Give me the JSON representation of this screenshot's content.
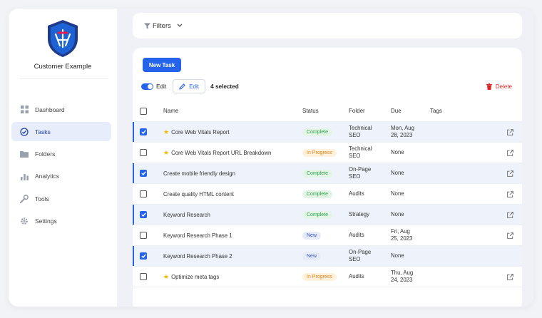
{
  "app": {
    "brand": "Customer Example"
  },
  "sidebar": {
    "items": [
      {
        "label": "Dashboard",
        "icon": "dashboard-icon",
        "active": false
      },
      {
        "label": "Tasks",
        "icon": "tasks-icon",
        "active": true
      },
      {
        "label": "Folders",
        "icon": "folder-icon",
        "active": false
      },
      {
        "label": "Analytics",
        "icon": "analytics-icon",
        "active": false
      },
      {
        "label": "Tools",
        "icon": "tools-icon",
        "active": false
      },
      {
        "label": "Settings",
        "icon": "gear-icon",
        "active": false
      }
    ]
  },
  "filters": {
    "label": "Filters"
  },
  "toolbar": {
    "new_task_label": "New Task",
    "toggle_label": "Edit",
    "edit_label": "Edit",
    "selected_text": "4 selected",
    "delete_label": "Delete"
  },
  "table": {
    "headers": {
      "name": "Name",
      "status": "Status",
      "folder": "Folder",
      "due": "Due",
      "tags": "Tags"
    },
    "rows": [
      {
        "checked": true,
        "starred": true,
        "name": "Core Web Vitals Report",
        "status": "Complete",
        "folder_line1": "Technical",
        "folder_line2": "SEO",
        "due_line1": "Mon, Aug",
        "due_line2": "28, 2023",
        "open_icon": true
      },
      {
        "checked": false,
        "starred": true,
        "name": "Core Web Vitals Report URL Breakdown",
        "status": "In Progress",
        "folder_line1": "Technical",
        "folder_line2": "SEO",
        "due_line1": "None",
        "due_line2": "",
        "open_icon": true
      },
      {
        "checked": true,
        "starred": false,
        "name": "Create mobile friendly design",
        "status": "Complete",
        "folder_line1": "On-Page",
        "folder_line2": "SEO",
        "due_line1": "None",
        "due_line2": "",
        "open_icon": true
      },
      {
        "checked": false,
        "starred": false,
        "name": "Create quality HTML content",
        "status": "Complete",
        "folder_line1": "Audits",
        "folder_line2": "",
        "due_line1": "None",
        "due_line2": "",
        "open_icon": true
      },
      {
        "checked": true,
        "starred": false,
        "name": "Keyword Research",
        "status": "Complete",
        "folder_line1": "Strategy",
        "folder_line2": "",
        "due_line1": "None",
        "due_line2": "",
        "open_icon": true
      },
      {
        "checked": false,
        "starred": false,
        "name": "Keyword Research Phase 1",
        "status": "New",
        "folder_line1": "Audits",
        "folder_line2": "",
        "due_line1": "Fri, Aug",
        "due_line2": "25, 2023",
        "open_icon": true
      },
      {
        "checked": true,
        "starred": false,
        "name": "Keyword Research Phase 2",
        "status": "New",
        "folder_line1": "On-Page",
        "folder_line2": "SEO",
        "due_line1": "None",
        "due_line2": "",
        "open_icon": false
      },
      {
        "checked": false,
        "starred": true,
        "name": "Optimize meta tags",
        "status": "In Progress",
        "folder_line1": "Audits",
        "folder_line2": "",
        "due_line1": "Thu, Aug",
        "due_line2": "24, 2023",
        "open_icon": true
      }
    ]
  },
  "colors": {
    "accent": "#2563eb",
    "complete": "#2e9e4a",
    "in_progress": "#e0841c",
    "new": "#3a53b8",
    "delete": "#dc2626"
  }
}
